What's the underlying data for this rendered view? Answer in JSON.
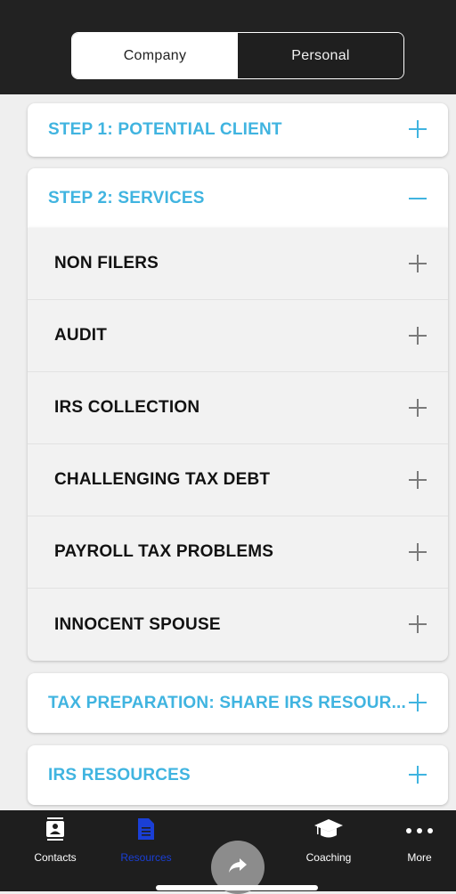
{
  "segmented_control": {
    "options": [
      "Company",
      "Personal"
    ],
    "selected": "Company"
  },
  "sections": {
    "step1": {
      "title": "STEP 1: POTENTIAL CLIENT",
      "expanded": false
    },
    "step2": {
      "title": "STEP 2: SERVICES",
      "expanded": true
    },
    "tax_prep": {
      "title": "TAX PREPARATION: SHARE IRS RESOUR...",
      "expanded": false
    },
    "irs_resources": {
      "title": "IRS RESOURCES",
      "expanded": false
    }
  },
  "services": [
    {
      "label": "NON FILERS"
    },
    {
      "label": "AUDIT"
    },
    {
      "label": "IRS COLLECTION"
    },
    {
      "label": "CHALLENGING TAX DEBT"
    },
    {
      "label": "PAYROLL TAX PROBLEMS"
    },
    {
      "label": "INNOCENT SPOUSE"
    }
  ],
  "tab_bar": {
    "tabs": [
      {
        "label": "Contacts",
        "icon": "contacts-icon"
      },
      {
        "label": "Resources",
        "icon": "document-icon",
        "active": true
      },
      {
        "label": "Coaching",
        "icon": "graduation-cap-icon"
      },
      {
        "label": "More",
        "icon": "more-dots-icon"
      }
    ],
    "center_action_icon": "share-arrow-icon"
  },
  "colors": {
    "accent": "#40b4e0",
    "active_tab": "#1a3fd6",
    "header_bg": "#222222",
    "tabbar_bg": "#1e1e1e"
  }
}
